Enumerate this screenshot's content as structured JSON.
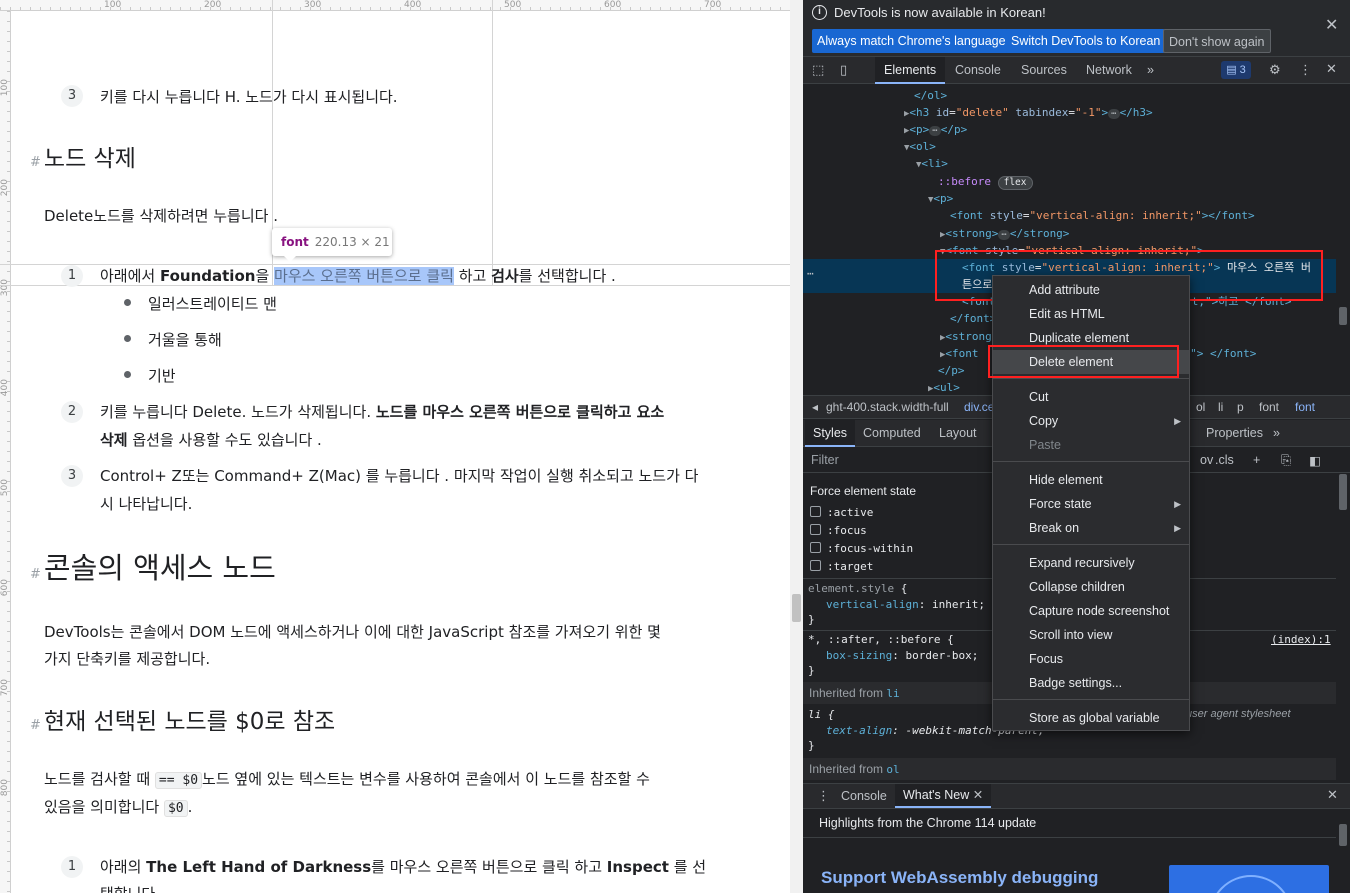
{
  "page": {
    "ruler_top_ticks": [
      "100",
      "200",
      "300",
      "400",
      "500",
      "600",
      "700"
    ],
    "ruler_left_ticks": [
      "100",
      "200",
      "300",
      "400",
      "500",
      "600",
      "700",
      "800"
    ],
    "step3_top": {
      "num": "3",
      "text": "키를 다시 누릅니다 H. 노드가 다시 표시됩니다."
    },
    "delete_heading": {
      "hash": "#",
      "text": "노드 삭제"
    },
    "delete_intro": {
      "code": "Delete",
      "text": "노드를 삭제하려면 누릅니다 ."
    },
    "tooltip": {
      "tag": "font",
      "dims": "220.13 × 21"
    },
    "step1": {
      "num": "1",
      "pre": "아래에서 ",
      "bold1": "Foundation",
      "mid1": "을 ",
      "highlight": "마우스 오른쪽 버튼으로 클릭",
      "mid2": " 하고 ",
      "bold2": "검사",
      "post": "를 선택합니다 ."
    },
    "bullets": [
      "일러스트레이티드 맨",
      "거울을 통해",
      "기반"
    ],
    "step2": {
      "num": "2",
      "pre": "키를 누릅니다 Delete. 노드가 삭제됩니다. ",
      "bold": "노드를 마우스 오른쪽 버튼으로 클릭하고 요소",
      "bold_line2": "삭제",
      "post": " 옵션을 사용할 수도 있습니다 ."
    },
    "step3": {
      "num": "3",
      "line1": "Control+ Z또는 Command+ Z(Mac) 를 누릅니다 . 마지막 작업이 실행 취소되고 노드가 다",
      "line2": "시 나타납니다."
    },
    "console_heading": {
      "hash": "#",
      "text": "콘솔의 액세스 노드"
    },
    "console_intro": {
      "line1": "DevTools는 콘솔에서 DOM 노드에 액세스하거나 이에 대한 JavaScript 참조를 가져오기 위한 몇",
      "line2": "가지 단축키를 제공합니다."
    },
    "ref_heading": {
      "hash": "#",
      "text": "현재 선택된 노드를 $0로 참조"
    },
    "ref_intro": {
      "pre": "노드를 검사할 때 ",
      "code1": "== $0",
      "line1_post": "노드 옆에 있는 텍스트는 변수를 사용하여 콘솔에서 이 노드를 참조할 수",
      "line2_pre": "있음을 의미합니다 ",
      "code2": "$0",
      "line2_post": "."
    },
    "step1b": {
      "num": "1",
      "pre": "아래의 ",
      "bold1": "The Left Hand of Darkness",
      "mid": "를 마우스 오른쪽 버튼으로 클릭 하고 ",
      "bold2": "Inspect",
      "post": " 를 선",
      "line2": "택합니다."
    }
  },
  "devtools": {
    "infobar": {
      "icon": "info-icon",
      "message": "DevTools is now available in Korean!",
      "btn_match": "Always match Chrome's language",
      "btn_switch": "Switch DevTools to Korean",
      "btn_dont": "Don't show again"
    },
    "tabs": [
      "Elements",
      "Console",
      "Sources",
      "Network"
    ],
    "more_tabs": "»",
    "issues_badge": "3",
    "dom": {
      "l1": "</ol>",
      "l2_tag": "<h3",
      "l2_attr1": "id",
      "l2_val1": "\"delete\"",
      "l2_attr2": "tabindex",
      "l2_val2": "\"-1\"",
      "l2_close": "</h3>",
      "l3_open": "<p>",
      "l3_close": "</p>",
      "l4": "<ol>",
      "l5": "<li>",
      "l6_pseudo": "::before",
      "l6_badge": "flex",
      "l7": "<p>",
      "l8_open": "<font",
      "l8_attr": "style",
      "l8_val": "\"vertical-align: inherit;\"",
      "l8_close": "></font>",
      "l9_open": "<strong>",
      "l9_close": "</strong>",
      "l10_open": "<font",
      "l10_attr": "style",
      "l10_val": "\"vertical-align: inherit;\"",
      "l10_close": ">",
      "sel_open": "<font",
      "sel_attr": "style",
      "sel_val": "\"vertical-align: inherit;\"",
      "sel_text": "마우스 오른쪽 버",
      "sel_text2": "튼으로",
      "l12_tag": "<font",
      "l12_tail": "t;\">하고 </font>",
      "l13": "</font>",
      "l14": "<strong>",
      "l15_tag": "<font",
      "l15_tail": "\"> </font>",
      "l16": "</p>",
      "l17": "<ul>"
    },
    "crumbs": [
      "ght-400.stack.width-full",
      "div.ce",
      "ol",
      "li",
      "p",
      "font",
      "font"
    ],
    "style_tabs": [
      "Styles",
      "Computed",
      "Layout",
      "Properties"
    ],
    "filter_placeholder": "Filter",
    "filter_tools": [
      ".cls"
    ],
    "filter_hov": "ov",
    "force_state_title": "Force element state",
    "states": [
      ":active",
      ":focus",
      ":focus-within",
      ":target"
    ],
    "rule1": {
      "selector": "element.style",
      "prop": "vertical-align",
      "value": "inherit"
    },
    "rule2": {
      "selector": "*, ::after, ::before",
      "source": "(index):1",
      "prop": "box-sizing",
      "value": "border-box"
    },
    "inherited_li": {
      "label": "Inherited from",
      "tag": "li"
    },
    "rule3": {
      "selector": "li",
      "source": "user agent stylesheet",
      "prop": "text-align",
      "value": "-webkit-match-parent"
    },
    "inherited_ol": {
      "label": "Inherited from",
      "tag": "ol"
    },
    "drawer_tabs": [
      "Console",
      "What's New"
    ],
    "drawer_headline": "Highlights from the Chrome 114 update",
    "drawer_big": "Support WebAssembly debugging"
  },
  "context_menu": {
    "items": [
      {
        "label": "Add attribute",
        "disabled": false,
        "submenu": false
      },
      {
        "label": "Edit as HTML",
        "disabled": false,
        "submenu": false
      },
      {
        "label": "Duplicate element",
        "disabled": false,
        "submenu": false
      },
      {
        "label": "Delete element",
        "disabled": false,
        "submenu": false
      },
      {
        "label": "Cut",
        "disabled": false,
        "submenu": false
      },
      {
        "label": "Copy",
        "disabled": false,
        "submenu": true
      },
      {
        "label": "Paste",
        "disabled": true,
        "submenu": false
      },
      {
        "label": "Hide element",
        "disabled": false,
        "submenu": false
      },
      {
        "label": "Force state",
        "disabled": false,
        "submenu": true
      },
      {
        "label": "Break on",
        "disabled": false,
        "submenu": true
      },
      {
        "label": "Expand recursively",
        "disabled": false,
        "submenu": false
      },
      {
        "label": "Collapse children",
        "disabled": false,
        "submenu": false
      },
      {
        "label": "Capture node screenshot",
        "disabled": false,
        "submenu": false
      },
      {
        "label": "Scroll into view",
        "disabled": false,
        "submenu": false
      },
      {
        "label": "Focus",
        "disabled": false,
        "submenu": false
      },
      {
        "label": "Badge settings...",
        "disabled": false,
        "submenu": false
      },
      {
        "label": "Store as global variable",
        "disabled": false,
        "submenu": false
      }
    ]
  },
  "colors": {
    "highlight_red": "#ff2020",
    "selection_bg": "#073655",
    "accent_blue": "#1967d2"
  }
}
